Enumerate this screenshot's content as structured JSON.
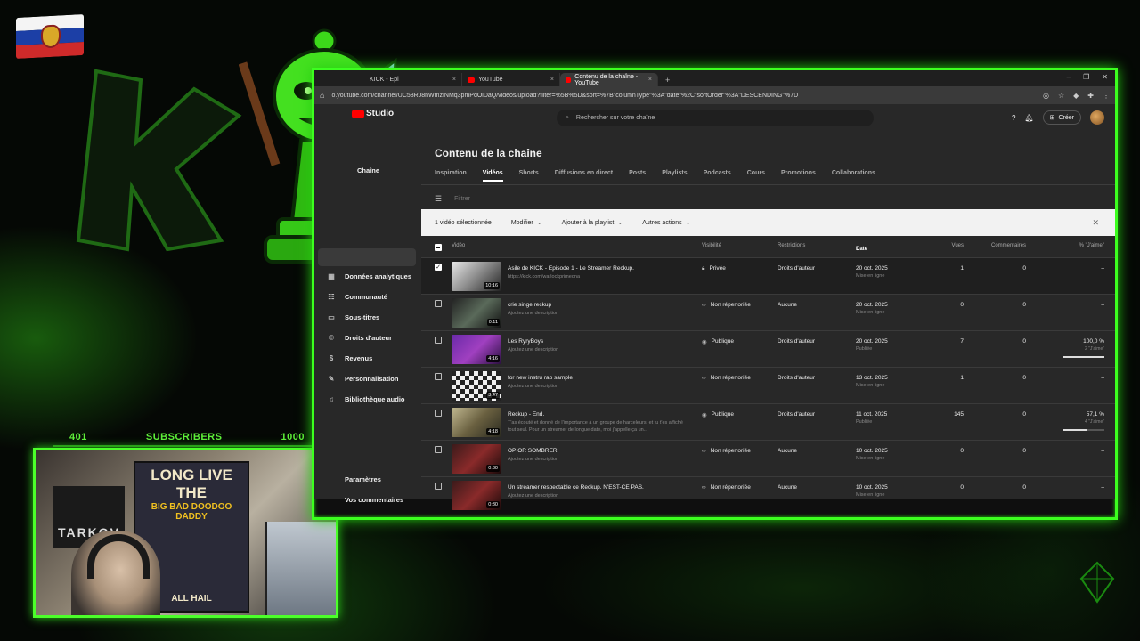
{
  "overlay": {
    "subs_current": "401",
    "subs_label": "SUBSCRIBERS",
    "subs_goal": "1000",
    "poster_line1": "LONG LIVE THE",
    "poster_line2": "BIG BAD DOODOO DADDY",
    "poster_line3": "ALL HAIL",
    "wall_text": "TARKOV"
  },
  "browser": {
    "tabs": [
      {
        "label": "KICK - Epi"
      },
      {
        "label": "YouTube"
      },
      {
        "label": "Contenu de la chaîne - YouTube"
      }
    ],
    "url": "o.youtube.com/channel/UC58RJ8nWmzINMq3pmPdOiDaQ/videos/upload?filter=%5B%5D&sort=%7B\"columnType\"%3A\"date\"%2C\"sortOrder\"%3A\"DESCENDING\"%7D"
  },
  "header": {
    "studio_label": "Studio",
    "search_placeholder": "Rechercher sur votre chaîne",
    "create_label": "Créer"
  },
  "sidebar": {
    "channel_label": "Chaîne",
    "items": [
      {
        "label": "Données analytiques",
        "icon": "chart-icon"
      },
      {
        "label": "Communauté",
        "icon": "community-icon"
      },
      {
        "label": "Sous-titres",
        "icon": "subtitles-icon"
      },
      {
        "label": "Droits d'auteur",
        "icon": "copyright-icon"
      },
      {
        "label": "Revenus",
        "icon": "dollar-icon"
      },
      {
        "label": "Personnalisation",
        "icon": "customize-icon"
      },
      {
        "label": "Bibliothèque audio",
        "icon": "audio-library-icon"
      }
    ],
    "bottom_items": [
      {
        "label": "Paramètres"
      },
      {
        "label": "Vos commentaires"
      }
    ]
  },
  "main": {
    "title": "Contenu de la chaîne",
    "tabs": [
      "Inspiration",
      "Vidéos",
      "Shorts",
      "Diffusions en direct",
      "Posts",
      "Playlists",
      "Podcasts",
      "Cours",
      "Promotions",
      "Collaborations"
    ],
    "active_tab": "Vidéos",
    "filter_placeholder": "Filtrer",
    "selection": {
      "count_label": "1 vidéo sélectionnée",
      "edit": "Modifier",
      "add_playlist": "Ajouter à la playlist",
      "more": "Autres actions"
    },
    "columns": {
      "video": "Vidéo",
      "visibility": "Visibilité",
      "restrictions": "Restrictions",
      "date": "Date",
      "views": "Vues",
      "comments": "Commentaires",
      "likes": "% \"J'aime\""
    },
    "rows": [
      {
        "title": "Asile de KICK - Episode 1 - Le Streamer Reckup.",
        "desc": "https://kick.com/warlockprimedna",
        "duration": "10:16",
        "visibility": "Privée",
        "restrictions": "Droits d'auteur",
        "date": "20 oct. 2025",
        "date_sub": "Mise en ligne",
        "views": "1",
        "comments": "0",
        "likes": "–",
        "likes_sub": "",
        "selected": true
      },
      {
        "title": "crie singe reckup",
        "desc": "Ajoutez une description",
        "duration": "0:11",
        "visibility": "Non répertoriée",
        "restrictions": "Aucune",
        "date": "20 oct. 2025",
        "date_sub": "Mise en ligne",
        "views": "0",
        "comments": "0",
        "likes": "–",
        "likes_sub": ""
      },
      {
        "title": "Les RyryBoys",
        "desc": "Ajoutez une description",
        "duration": "4:16",
        "visibility": "Publique",
        "restrictions": "Droits d'auteur",
        "date": "20 oct. 2025",
        "date_sub": "Publiée",
        "views": "7",
        "comments": "0",
        "likes": "100,0 %",
        "likes_sub": "2 \"J'aime\"",
        "like_ratio": 1.0
      },
      {
        "title": "for new instru rap sample",
        "desc": "Ajoutez une description",
        "duration": "3:47",
        "visibility": "Non répertoriée",
        "restrictions": "Droits d'auteur",
        "date": "13 oct. 2025",
        "date_sub": "Mise en ligne",
        "views": "1",
        "comments": "0",
        "likes": "–",
        "likes_sub": ""
      },
      {
        "title": "Reckup - End.",
        "desc": "T'as écouté et donné de l'importance à un groupe de harceleurs, et tu t'es affiché tout seul. Pour un streamer de longue date, moi j'appelle ça un...",
        "duration": "4:18",
        "visibility": "Publique",
        "restrictions": "Droits d'auteur",
        "date": "11 oct. 2025",
        "date_sub": "Publiée",
        "views": "145",
        "comments": "0",
        "likes": "57,1 %",
        "likes_sub": "4 \"J'aime\"",
        "like_ratio": 0.571
      },
      {
        "title": "OPIOR SOMBRER",
        "desc": "Ajoutez une description",
        "duration": "0:30",
        "visibility": "Non répertoriée",
        "restrictions": "Aucune",
        "date": "10 oct. 2025",
        "date_sub": "Mise en ligne",
        "views": "0",
        "comments": "0",
        "likes": "–",
        "likes_sub": ""
      },
      {
        "title": "Un streamer respectable ce Reckup. N'EST-CE PAS.",
        "desc": "Ajoutez une description",
        "duration": "0:30",
        "visibility": "Non répertoriée",
        "restrictions": "Aucune",
        "date": "10 oct. 2025",
        "date_sub": "Mise en ligne",
        "views": "0",
        "comments": "0",
        "likes": "–",
        "likes_sub": ""
      }
    ]
  },
  "colors": {
    "frame_green": "#3cff1f",
    "studio_bg": "#282828",
    "selection_bar": "#f2f2f2"
  }
}
